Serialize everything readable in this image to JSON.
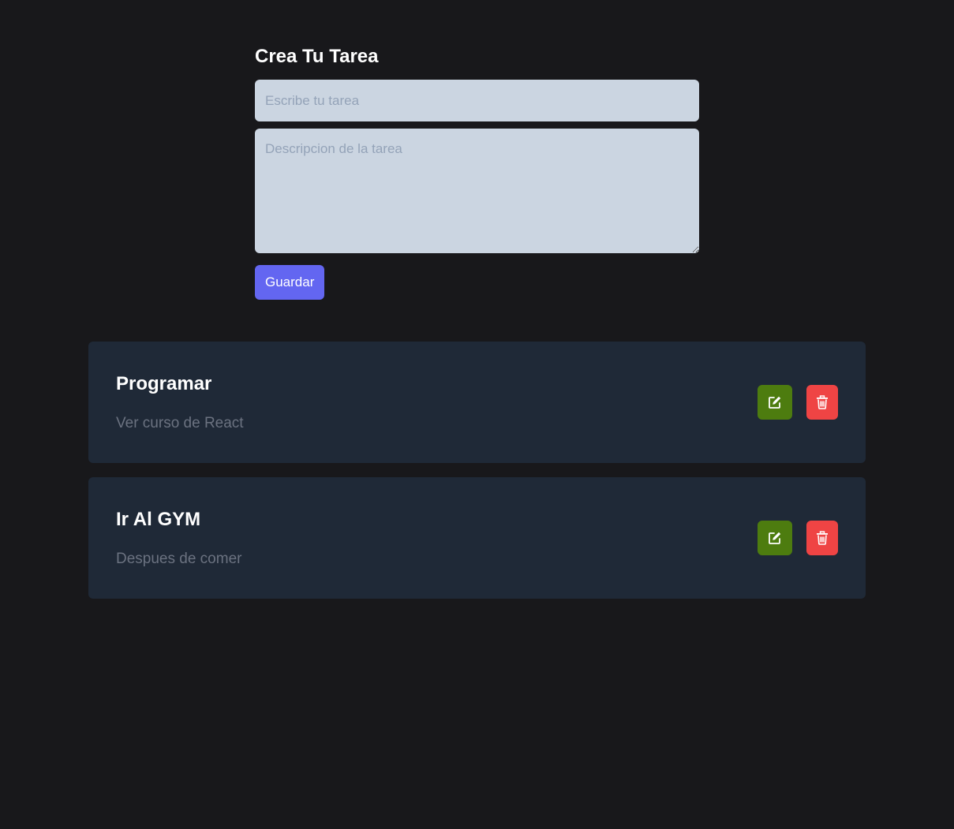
{
  "form": {
    "title": "Crea Tu Tarea",
    "title_input": {
      "placeholder": "Escribe tu tarea",
      "value": ""
    },
    "description_input": {
      "placeholder": "Descripcion de la tarea",
      "value": ""
    },
    "save_label": "Guardar"
  },
  "tasks": [
    {
      "title": "Programar",
      "description": "Ver curso de React",
      "edit_icon": "edit-icon",
      "delete_icon": "trash-icon"
    },
    {
      "title": "Ir Al GYM",
      "description": "Despues de comer",
      "edit_icon": "edit-icon",
      "delete_icon": "trash-icon"
    }
  ],
  "colors": {
    "background": "#18181b",
    "input_bg": "#cbd5e1",
    "save_button": "#6366f1",
    "card_bg": "#1f2937",
    "edit_button": "#4d7c0f",
    "delete_button": "#ef4444"
  }
}
